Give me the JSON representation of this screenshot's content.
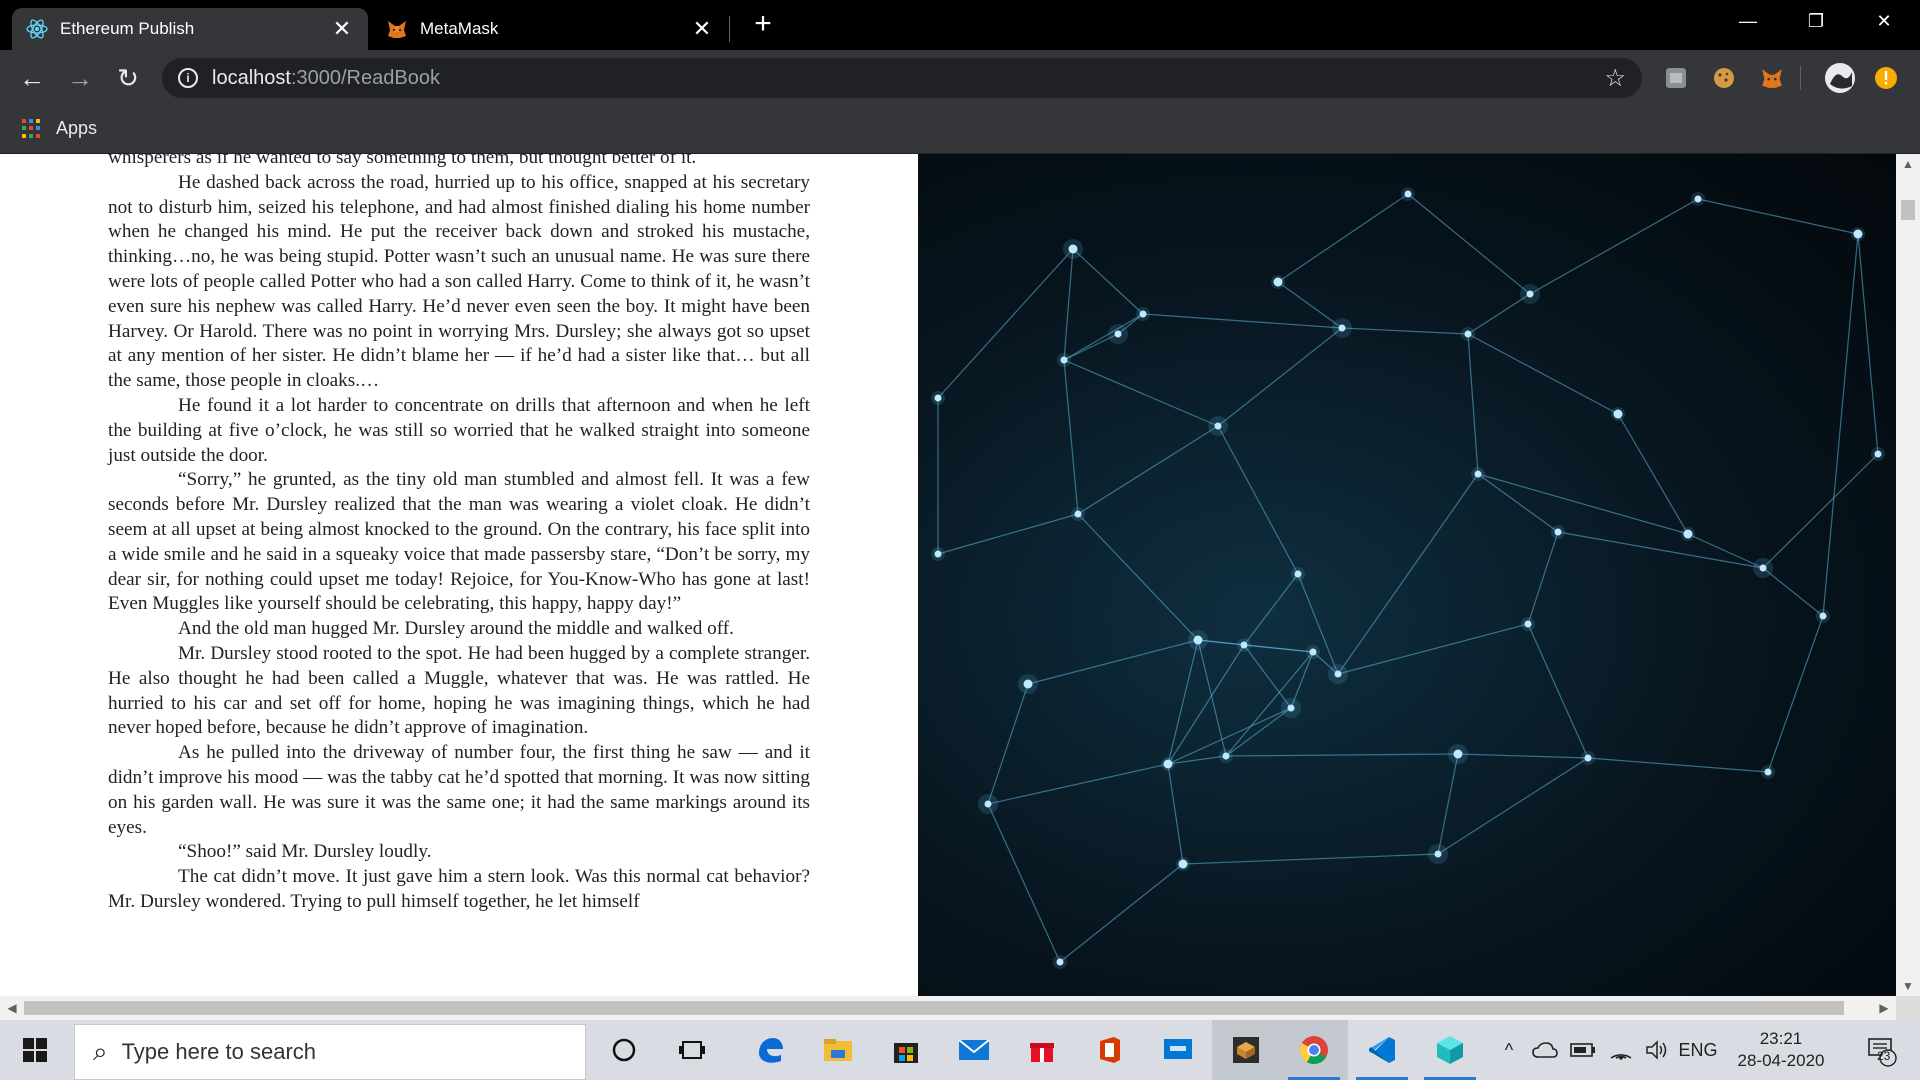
{
  "browser": {
    "tabs": [
      {
        "title": "Ethereum Publish",
        "active": true,
        "icon": "react-icon"
      },
      {
        "title": "MetaMask",
        "active": false,
        "icon": "metamask-fox-icon"
      }
    ],
    "new_tab": "+",
    "window_controls": {
      "minimize": "—",
      "restore": "❐",
      "close": "✕"
    },
    "nav": {
      "back": "←",
      "forward": "→",
      "reload": "↻"
    },
    "url": {
      "host": "localhost",
      "rest": ":3000/ReadBook"
    },
    "bookmark_star": "☆",
    "bookmarks": {
      "apps_label": "Apps"
    }
  },
  "book": {
    "paragraphs": [
      "whisperers as if he wanted to say something to them, but thought better of it.",
      "He dashed back across the road, hurried up to his office, snapped at his secretary not to disturb him, seized his telephone, and had almost finished dialing his home number when he changed his mind. He put the receiver back down and stroked his mustache, thinking…no, he was being stupid. Potter wasn’t such an unusual name. He was sure there were lots of people called Potter who had a son called Harry. Come to think of it, he wasn’t even sure his nephew was called Harry. He’d never even seen the boy. It might have been Harvey. Or Harold. There was no point in worrying Mrs. Dursley; she always got so upset at any mention of her sister. He didn’t blame her — if he’d had a sister like that… but all the same, those people in cloaks.…",
      "He found it a lot harder to concentrate on drills that afternoon and when he left the building at five o’clock, he was still so worried that he walked straight into someone just outside the door.",
      "“Sorry,” he grunted, as the tiny old man stumbled and almost fell. It was a few seconds before Mr. Dursley realized that the man was wearing a violet cloak. He didn’t seem at all upset at being almost knocked to the ground. On the contrary, his face split into a wide smile and he said in a squeaky voice that made passersby stare, “Don’t be sorry, my dear sir, for nothing could upset me today! Rejoice, for You-Know-Who has gone at last! Even Muggles like yourself should be celebrating, this happy, happy day!”",
      "And the old man hugged Mr. Dursley around the middle and walked off.",
      "Mr. Dursley stood rooted to the spot. He had been hugged by a complete stranger. He also thought he had been called a Muggle, whatever that was. He was rattled. He hurried to his car and set off for home, hoping he was imagining things, which he had never hoped before, because he didn’t approve of imagination.",
      "As he pulled into the driveway of number four, the first thing he saw — and it didn’t improve his mood — was the tabby cat he’d spotted that morning. It was now sitting on his garden wall. He was sure it was the same one; it had the same markings around its eyes.",
      "“Shoo!” said Mr. Dursley loudly.",
      "The cat didn’t move. It just gave him a stern look. Was this normal cat behavior? Mr. Dursley wondered. Trying to pull himself together, he let himself"
    ]
  },
  "taskbar": {
    "search_placeholder": "Type here to search",
    "tray": {
      "language": "ENG",
      "time": "23:21",
      "date": "28-04-2020",
      "notifications": "23"
    }
  },
  "colors": {
    "accent": "#2b78d6",
    "network_node": "#bfe9ff",
    "network_line": "#5fb6dd"
  }
}
